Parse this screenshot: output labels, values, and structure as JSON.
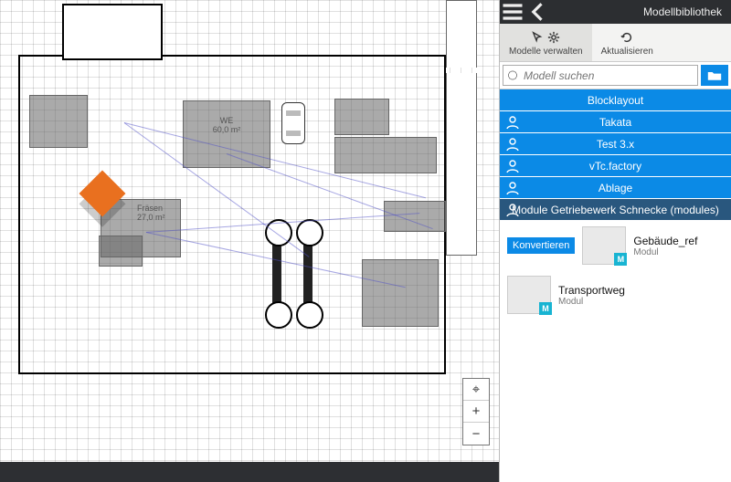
{
  "panel": {
    "title": "Modellbibliothek",
    "toolbar": {
      "manage": "Modelle verwalten",
      "refresh": "Aktualisieren"
    },
    "search": {
      "placeholder": "Modell suchen"
    },
    "categories": [
      {
        "label": "Blocklayout"
      },
      {
        "label": "Takata"
      },
      {
        "label": "Test 3.x"
      },
      {
        "label": "vTc.factory"
      },
      {
        "label": "Ablage"
      },
      {
        "label": "Module Getriebewerk Schnecke (modules)",
        "selected": true
      }
    ],
    "items": [
      {
        "name": "Gebäude_ref",
        "type": "Modul",
        "convert": "Konvertieren",
        "badge": "M"
      },
      {
        "name": "Transportweg",
        "type": "Modul",
        "badge": "M"
      }
    ]
  },
  "canvas": {
    "rooms": {
      "we": {
        "name": "WE",
        "area": "60,0 m²"
      },
      "fraesen": {
        "name": "Fräsen",
        "area": "27,0 m²"
      }
    },
    "nav": {
      "compass": "⌖",
      "plus": "+",
      "minus": "−"
    }
  }
}
